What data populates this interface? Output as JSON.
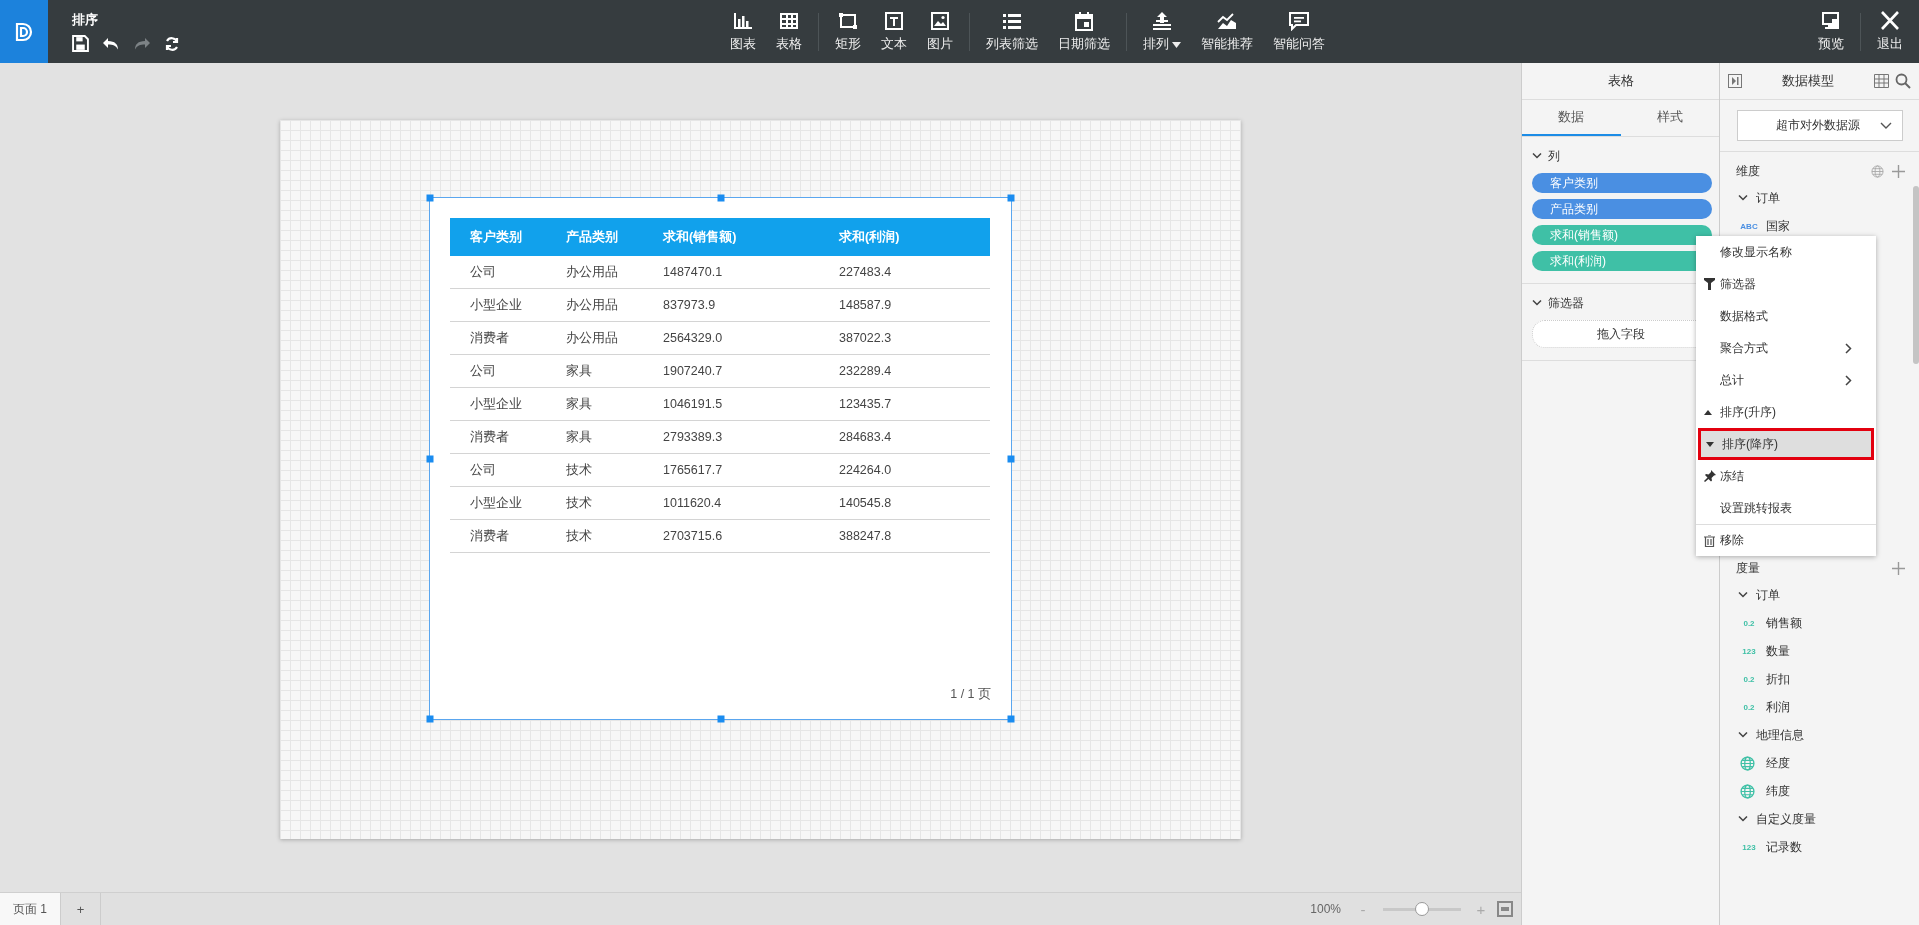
{
  "header": {
    "title": "排序",
    "quick_actions": [
      {
        "kind": "save",
        "disabled": false
      },
      {
        "kind": "undo",
        "disabled": false
      },
      {
        "kind": "redo",
        "disabled": true
      },
      {
        "kind": "refresh",
        "disabled": false
      }
    ],
    "toolbar_groups": [
      [
        {
          "label": "图表",
          "kind": "chart",
          "dropdown": false
        },
        {
          "label": "表格",
          "kind": "table",
          "dropdown": false
        }
      ],
      [
        {
          "label": "矩形",
          "kind": "rect",
          "dropdown": false
        },
        {
          "label": "文本",
          "kind": "text",
          "dropdown": false
        },
        {
          "label": "图片",
          "kind": "image",
          "dropdown": false
        }
      ],
      [
        {
          "label": "列表筛选",
          "kind": "list",
          "dropdown": false
        },
        {
          "label": "日期筛选",
          "kind": "calendar",
          "dropdown": false
        }
      ],
      [
        {
          "label": "排列",
          "kind": "arrange",
          "dropdown": true
        },
        {
          "label": "智能推荐",
          "kind": "trend",
          "dropdown": false
        },
        {
          "label": "智能问答",
          "kind": "chat",
          "dropdown": false
        }
      ]
    ],
    "right_actions": [
      {
        "label": "预览",
        "kind": "preview"
      },
      {
        "label": "退出",
        "kind": "close"
      }
    ]
  },
  "canvas": {
    "widget": {
      "selected": true,
      "table": {
        "columns": [
          "客户类别",
          "产品类别",
          "求和(销售额)",
          "求和(利润)"
        ],
        "rows": [
          [
            "公司",
            "办公用品",
            "1487470.1",
            "227483.4"
          ],
          [
            "小型企业",
            "办公用品",
            "837973.9",
            "148587.9"
          ],
          [
            "消费者",
            "办公用品",
            "2564329.0",
            "387022.3"
          ],
          [
            "公司",
            "家具",
            "1907240.7",
            "232289.4"
          ],
          [
            "小型企业",
            "家具",
            "1046191.5",
            "123435.7"
          ],
          [
            "消费者",
            "家具",
            "2793389.3",
            "284683.4"
          ],
          [
            "公司",
            "技术",
            "1765617.7",
            "224264.0"
          ],
          [
            "小型企业",
            "技术",
            "1011620.4",
            "140545.8"
          ],
          [
            "消费者",
            "技术",
            "2703715.6",
            "388247.8"
          ]
        ]
      },
      "pager": "1 / 1 页"
    }
  },
  "bottom_bar": {
    "pages": [
      {
        "label": "页面 1",
        "selected": true
      }
    ],
    "add": "+",
    "zoom_reading": "100%",
    "zoom_out": "-",
    "zoom_in": "+",
    "zoom_slider": {
      "level": 0.5
    }
  },
  "properties_panel": {
    "title": "表格",
    "tabs": [
      {
        "label": "数据",
        "selected": true
      },
      {
        "label": "样式",
        "selected": false
      }
    ],
    "columns_section": {
      "title": "列",
      "expanded": true,
      "fields": [
        {
          "label": "客户类别",
          "color": "#4a8fe2"
        },
        {
          "label": "产品类别",
          "color": "#4a8fe2"
        },
        {
          "label": "求和(销售额)",
          "color": "#3fc0a6"
        },
        {
          "label": "求和(利润)",
          "color": "#3fc0a6"
        }
      ]
    },
    "filter_section": {
      "title": "筛选器",
      "expanded": true,
      "drop_zone": "拖入字段"
    }
  },
  "data_model": {
    "title": "数据模型",
    "source": "超市对外数据源",
    "dimensions": {
      "title": "维度",
      "groups": [
        {
          "label": "订单",
          "expanded": true,
          "children": [
            {
              "label": "国家",
              "kind": "text",
              "type_label": "ABC"
            }
          ]
        }
      ]
    },
    "measures": {
      "title": "度量",
      "groups": [
        {
          "label": "订单",
          "expanded": true,
          "children": [
            {
              "label": "销售额",
              "kind": "number",
              "type_label": "0.2"
            },
            {
              "label": "数量",
              "kind": "number",
              "type_label": "123"
            },
            {
              "label": "折扣",
              "kind": "number",
              "type_label": "0.2"
            },
            {
              "label": "利润",
              "kind": "number",
              "type_label": "0.2"
            }
          ]
        },
        {
          "label": "地理信息",
          "expanded": true,
          "children": [
            {
              "label": "经度",
              "kind": "geo"
            },
            {
              "label": "纬度",
              "kind": "geo"
            }
          ]
        },
        {
          "label": "自定义度量",
          "expanded": true,
          "children": [
            {
              "label": "记录数",
              "kind": "number",
              "type_label": "123"
            }
          ]
        }
      ]
    }
  },
  "context_menu": {
    "items": [
      {
        "label": "修改显示名称",
        "kind": "plain",
        "submenu": false,
        "selected": false,
        "divider_before": false
      },
      {
        "label": "筛选器",
        "kind": "filter",
        "submenu": false,
        "selected": false,
        "divider_before": false
      },
      {
        "label": "数据格式",
        "kind": "plain",
        "submenu": false,
        "selected": false,
        "divider_before": false
      },
      {
        "label": "聚合方式",
        "kind": "plain",
        "submenu": true,
        "selected": false,
        "divider_before": false
      },
      {
        "label": "总计",
        "kind": "plain",
        "submenu": true,
        "selected": false,
        "divider_before": false
      },
      {
        "label": "排序(升序)",
        "kind": "asc",
        "submenu": false,
        "selected": false,
        "divider_before": false
      },
      {
        "label": "排序(降序)",
        "kind": "desc",
        "submenu": false,
        "selected": true,
        "divider_before": false
      },
      {
        "label": "冻结",
        "kind": "pin",
        "submenu": false,
        "selected": false,
        "divider_before": false
      },
      {
        "label": "设置跳转报表",
        "kind": "plain",
        "submenu": false,
        "selected": false,
        "divider_before": false
      },
      {
        "label": "移除",
        "kind": "trash",
        "submenu": false,
        "selected": false,
        "divider_before": true
      }
    ]
  }
}
